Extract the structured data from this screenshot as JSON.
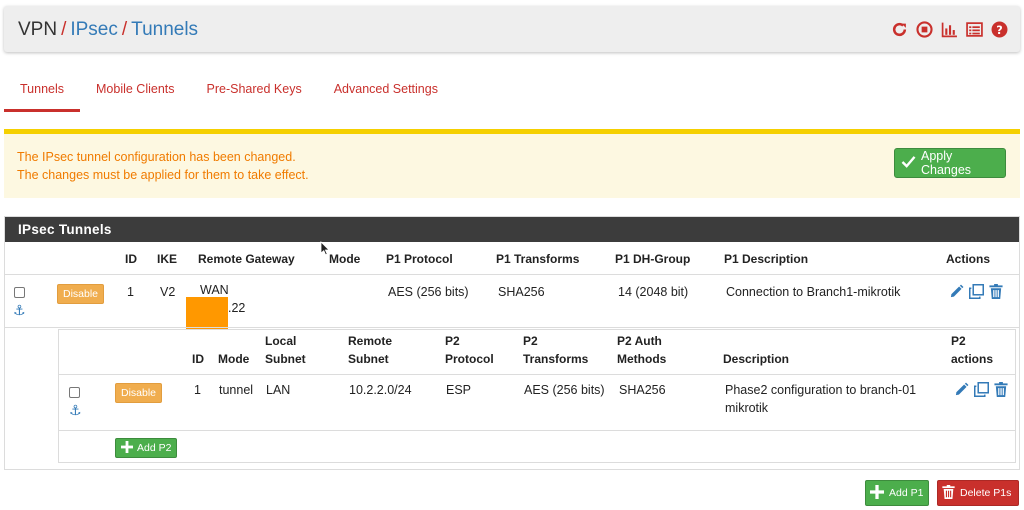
{
  "breadcrumb": {
    "part1": "VPN",
    "sep": "/",
    "part2": "IPsec",
    "part3": "Tunnels"
  },
  "header_icons": [
    "restart-icon",
    "stop-icon",
    "chart-icon",
    "list-icon",
    "help-icon"
  ],
  "tabs": [
    {
      "label": "Tunnels",
      "active": true
    },
    {
      "label": "Mobile Clients",
      "active": false
    },
    {
      "label": "Pre-Shared Keys",
      "active": false
    },
    {
      "label": "Advanced Settings",
      "active": false
    }
  ],
  "alert": {
    "line1": "The IPsec tunnel configuration has been changed.",
    "line2": "The changes must be applied for them to take effect.",
    "button": "Apply Changes"
  },
  "panel": {
    "title": "IPsec Tunnels",
    "headers": {
      "id": "ID",
      "ike": "IKE",
      "remote_gateway": "Remote Gateway",
      "mode": "Mode",
      "p1_protocol": "P1 Protocol",
      "p1_transforms": "P1 Transforms",
      "p1_dh_group": "P1 DH-Group",
      "p1_description": "P1 Description",
      "actions": "Actions"
    },
    "row": {
      "disable_label": "Disable",
      "id": "1",
      "ike": "V2",
      "gateway_line1": "WAN",
      "gateway_line2": ".22",
      "protocol": "AES (256 bits)",
      "transforms": "SHA256",
      "dh_group": "14 (2048 bit)",
      "description": "Connection to Branch1-mikrotik"
    }
  },
  "phase2": {
    "headers": {
      "id": "ID",
      "mode": "Mode",
      "local_subnet_1": "Local",
      "local_subnet_2": "Subnet",
      "remote_subnet_1": "Remote",
      "remote_subnet_2": "Subnet",
      "p2_protocol_1": "P2",
      "p2_protocol_2": "Protocol",
      "p2_transforms_1": "P2",
      "p2_transforms_2": "Transforms",
      "p2_auth_1": "P2 Auth",
      "p2_auth_2": "Methods",
      "description": "Description",
      "actions_1": "P2",
      "actions_2": "actions"
    },
    "row": {
      "disable_label": "Disable",
      "id": "1",
      "mode": "tunnel",
      "local_subnet": "LAN",
      "remote_subnet": "10.2.2.0/24",
      "protocol": "ESP",
      "transforms": "AES (256 bits)",
      "auth": "SHA256",
      "description_line1": "Phase2 configuration to branch-01",
      "description_line2": "mikrotik"
    },
    "add_button": "Add P2"
  },
  "footer": {
    "add_p1": "Add P1",
    "delete_p1s": "Delete P1s"
  },
  "colors": {
    "accent": "#c9302c",
    "link": "#337ab7",
    "success": "#4cae4c",
    "warning": "#f0ad4e"
  }
}
